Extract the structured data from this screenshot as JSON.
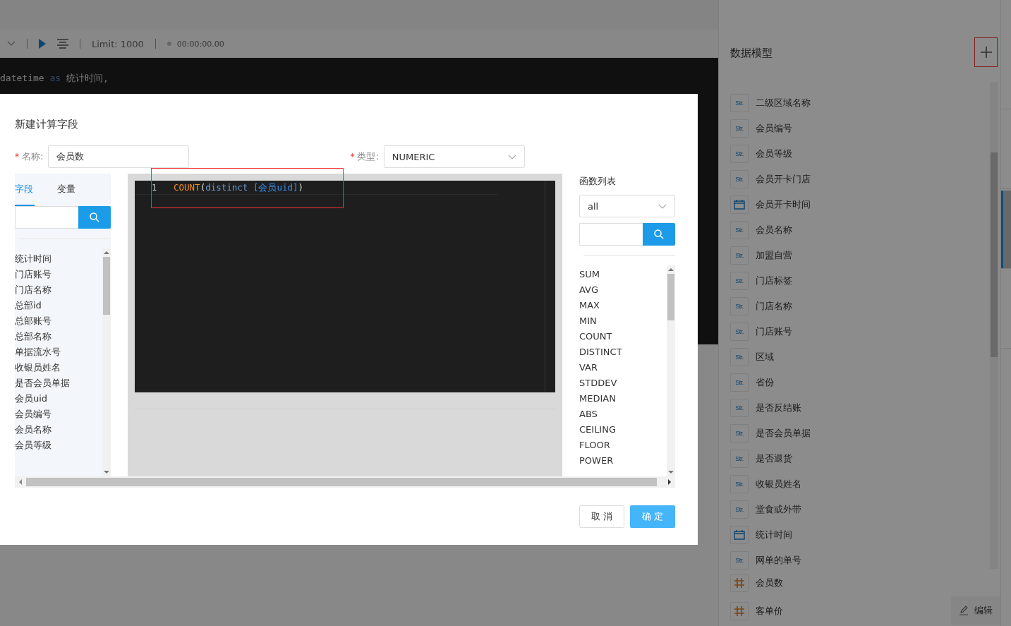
{
  "toolbar": {
    "limit": "Limit: 1000",
    "timer": "00:00:00.00"
  },
  "background_code": [
    {
      "tokens": [
        {
          "kind": "ident",
          "text": "datetime"
        },
        {
          "kind": "keyword",
          "text": "as"
        },
        {
          "kind": "ident",
          "text": "统计时间,"
        }
      ]
    }
  ],
  "data_model": {
    "title": "数据模型",
    "fields": [
      {
        "kind": "str",
        "type_label": "Str.",
        "name": "二级区域名称"
      },
      {
        "kind": "str",
        "type_label": "Str.",
        "name": "会员编号"
      },
      {
        "kind": "str",
        "type_label": "Str.",
        "name": "会员等级"
      },
      {
        "kind": "str",
        "type_label": "Str.",
        "name": "会员开卡门店"
      },
      {
        "kind": "date",
        "name": "会员开卡时间"
      },
      {
        "kind": "str",
        "type_label": "Str.",
        "name": "会员名称"
      },
      {
        "kind": "str",
        "type_label": "Str.",
        "name": "加盟自营"
      },
      {
        "kind": "str",
        "type_label": "Str.",
        "name": "门店标签"
      },
      {
        "kind": "str",
        "type_label": "Str.",
        "name": "门店名称"
      },
      {
        "kind": "str",
        "type_label": "Str.",
        "name": "门店账号"
      },
      {
        "kind": "str",
        "type_label": "Str.",
        "name": "区域"
      },
      {
        "kind": "str",
        "type_label": "Str.",
        "name": "省份"
      },
      {
        "kind": "str",
        "type_label": "Str.",
        "name": "是否反结账"
      },
      {
        "kind": "str",
        "type_label": "Str.",
        "name": "是否会员单据"
      },
      {
        "kind": "str",
        "type_label": "Str.",
        "name": "是否退货"
      },
      {
        "kind": "str",
        "type_label": "Str.",
        "name": "收银员姓名"
      },
      {
        "kind": "str",
        "type_label": "Str.",
        "name": "堂食或外带"
      },
      {
        "kind": "date",
        "name": "统计时间"
      },
      {
        "kind": "str",
        "type_label": "Str.",
        "name": "网单的单号"
      }
    ],
    "calculated_fields": [
      {
        "kind": "num",
        "name": "会员数"
      },
      {
        "kind": "num",
        "name": "客单价"
      }
    ],
    "edit_button": "编辑"
  },
  "side_tabs": [
    {
      "selected": false
    },
    {
      "selected": false
    },
    {
      "selected": true
    },
    {
      "selected": false
    }
  ],
  "dialog": {
    "title": "新建计算字段",
    "required_mark": "*",
    "name_label": "名称:",
    "name_value": "会员数",
    "type_label": "类型:",
    "type_value": "NUMERIC",
    "tabs": [
      {
        "label": "字段",
        "selected": true
      },
      {
        "label": "变量",
        "selected": false
      }
    ],
    "fields": [
      "统计时间",
      "门店账号",
      "门店名称",
      "总部id",
      "总部账号",
      "总部名称",
      "单据流水号",
      "收银员姓名",
      "是否会员单据",
      "会员uid",
      "会员编号",
      "会员名称",
      "会员等级"
    ],
    "editor": {
      "line_number": "1",
      "tokens": [
        {
          "kind": "function",
          "text": "COUNT"
        },
        {
          "kind": "punct",
          "text": "("
        },
        {
          "kind": "keyword",
          "text": "distinct "
        },
        {
          "kind": "field",
          "text": "[会员uid]"
        },
        {
          "kind": "punct",
          "text": ")"
        }
      ]
    },
    "functions_title": "函数列表",
    "function_category": "all",
    "functions": [
      "SUM",
      "AVG",
      "MAX",
      "MIN",
      "COUNT",
      "DISTINCT",
      "VAR",
      "STDDEV",
      "MEDIAN",
      "ABS",
      "CEILING",
      "FLOOR",
      "POWER"
    ],
    "buttons": [
      {
        "kind": "secondary",
        "label": "取 消"
      },
      {
        "kind": "primary",
        "label": "确 定"
      }
    ]
  }
}
